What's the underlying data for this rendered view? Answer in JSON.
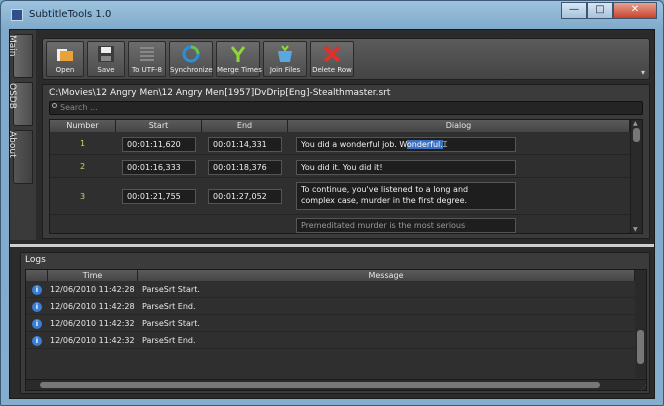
{
  "window": {
    "title": "SubtitleTools 1.0",
    "min_label": "—",
    "max_label": "□",
    "close_label": "✕"
  },
  "side_tabs": [
    {
      "label": "Main"
    },
    {
      "label": "OSDB"
    },
    {
      "label": "About"
    }
  ],
  "toolbar": {
    "open": "Open",
    "save": "Save",
    "utf8": "To UTF-8",
    "sync": "Synchronize",
    "merge": "Merge Times",
    "join": "Join Files",
    "delete": "Delete Row",
    "more": "▾"
  },
  "file": {
    "path": "C:\\Movies\\12 Angry Men\\12 Angry Men[1957]DvDrip[Eng]-Stealthmaster.srt",
    "search_placeholder": "Search ..."
  },
  "grid": {
    "columns": [
      "Number",
      "Start",
      "End",
      "Dialog"
    ],
    "rows": [
      {
        "number": "1",
        "start": "00:01:11,620",
        "end": "00:01:14,331",
        "dialog_a": "You did a wonderful job. W",
        "dialog_sel": "onderful.",
        "dialog_b": ""
      },
      {
        "number": "2",
        "start": "00:01:16,333",
        "end": "00:01:18,376",
        "dialog_a": "You did it. You did it!",
        "dialog_sel": "",
        "dialog_b": ""
      },
      {
        "number": "3",
        "start": "00:01:21,755",
        "end": "00:01:27,052",
        "dialog_a": "To continue, you've listened to a long and",
        "dialog_sel": "",
        "dialog_b": "complex case, murder in the first degree."
      },
      {
        "number": "",
        "start": "",
        "end": "",
        "dialog_a": "Premeditated murder is the most serious",
        "dialog_sel": "",
        "dialog_b": ""
      }
    ]
  },
  "logs": {
    "title": "Logs",
    "columns": [
      "Time",
      "Message"
    ],
    "rows": [
      {
        "icon": "info-icon",
        "time": "12/06/2010 11:42:28",
        "message": "ParseSrt Start."
      },
      {
        "icon": "info-icon",
        "time": "12/06/2010 11:42:28",
        "message": "ParseSrt End."
      },
      {
        "icon": "info-icon",
        "time": "12/06/2010 11:42:32",
        "message": "ParseSrt Start."
      },
      {
        "icon": "info-icon",
        "time": "12/06/2010 11:42:32",
        "message": "ParseSrt End."
      }
    ]
  },
  "colors": {
    "accent_number": "#c8d86a",
    "selection": "#3b6fbf",
    "close_button": "#c9422c"
  }
}
